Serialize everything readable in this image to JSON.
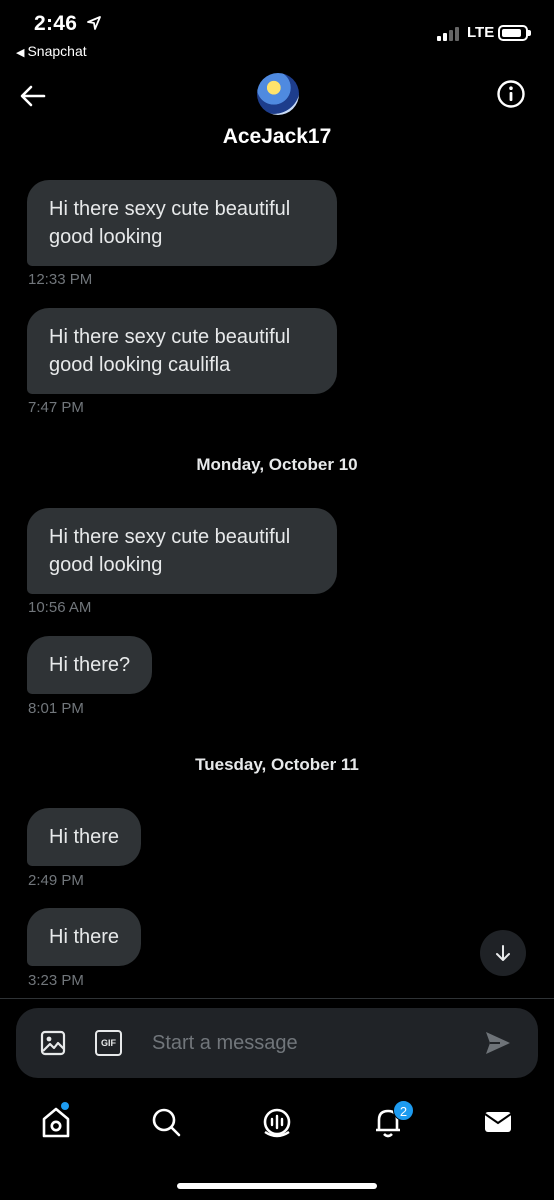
{
  "status_bar": {
    "time": "2:46",
    "back_app": "Snapchat",
    "network": "LTE"
  },
  "header": {
    "username": "AceJack17"
  },
  "messages": [
    {
      "text": "Hi there sexy cute beautiful good looking",
      "time": "12:33 PM"
    },
    {
      "text": "Hi there sexy cute beautiful good looking caulifla",
      "time": "7:47 PM"
    },
    {
      "separator": "Monday, October 10"
    },
    {
      "text": "Hi there sexy cute beautiful good looking",
      "time": "10:56 AM"
    },
    {
      "text": "Hi there?",
      "time": "8:01 PM"
    },
    {
      "separator": "Tuesday, October 11"
    },
    {
      "text": "Hi there",
      "time": "2:49 PM"
    },
    {
      "text": "Hi there",
      "time": "3:23 PM"
    }
  ],
  "composer": {
    "placeholder": "Start a message",
    "gif_label": "GIF"
  },
  "bottom_nav": {
    "items": [
      "home-icon",
      "search-icon",
      "spaces-icon",
      "notifications-icon",
      "messages-icon"
    ],
    "notifications_badge": "2"
  },
  "colors": {
    "background": "#000000",
    "bubble": "#2f3336",
    "accent": "#1d9bf0",
    "muted_text": "#71767b"
  }
}
